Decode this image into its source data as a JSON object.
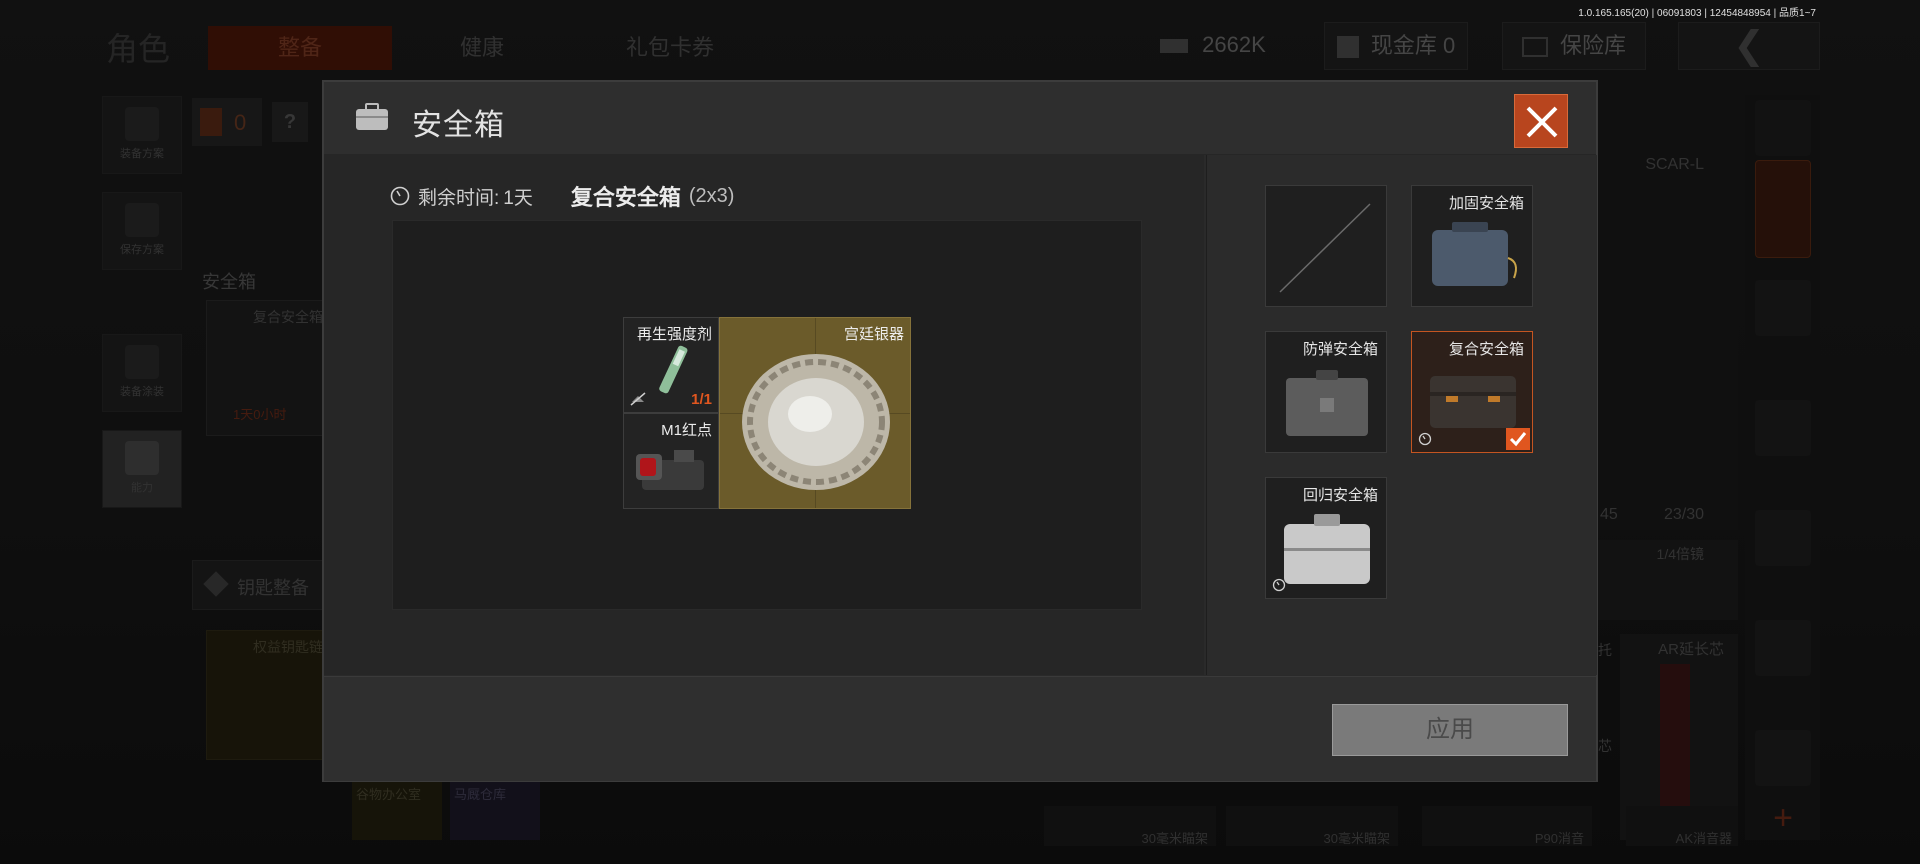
{
  "version_text": "1.0.165.165(20) | 06091803 | 12454848954 | 品质1~7",
  "background": {
    "section_title": "角色",
    "tabs": [
      {
        "label": "整备",
        "active": true
      },
      {
        "label": "健康",
        "active": false
      },
      {
        "label": "礼包卡券",
        "active": false
      }
    ],
    "currency": "2662K",
    "cash_vault": "现金库 0",
    "insurance_vault": "保险库",
    "side_buttons": [
      "装备方案",
      "保存方案",
      "装备涂装",
      "能力"
    ],
    "armor_count": "0",
    "help_mark": "?",
    "safebox_section_label": "安全箱",
    "safebox_card_name": "复合安全箱",
    "safebox_card_timer": "1天0小时",
    "key_section_label": "钥匙整备",
    "key_card_name": "权益钥匙链",
    "bottom_items": [
      "谷物办公室",
      "马厩仓库",
      "30毫米瞄架",
      "30毫米瞄架",
      "P90消音",
      "AK消音器"
    ],
    "weapon_name": "SCAR-L",
    "ammo_left": "45",
    "ammo_count": "23/30",
    "scope_label": "1/4倍镜",
    "right_item_label": "AR延长芯",
    "partial_label_a": "托",
    "partial_label_b": "芯"
  },
  "modal": {
    "title": "安全箱",
    "time_label": "剩余时间:",
    "time_value": "1天",
    "case_name": "复合安全箱",
    "case_size": "(2x3)",
    "items": [
      {
        "name": "再生强度剂",
        "count": "1/1"
      },
      {
        "name": "宫廷银器"
      },
      {
        "name": "M1红点"
      }
    ],
    "slots": [
      {
        "label": "",
        "empty": true,
        "selected": false,
        "timed": false
      },
      {
        "label": "加固安全箱",
        "empty": false,
        "selected": false,
        "timed": false
      },
      {
        "label": "防弹安全箱",
        "empty": false,
        "selected": false,
        "timed": false
      },
      {
        "label": "复合安全箱",
        "empty": false,
        "selected": true,
        "timed": true
      },
      {
        "label": "回归安全箱",
        "empty": false,
        "selected": false,
        "timed": true
      }
    ],
    "apply_label": "应用"
  },
  "colors": {
    "accent": "#c45521",
    "gold_highlight": "#6b5b2a",
    "close_bg": "#b8451e"
  }
}
